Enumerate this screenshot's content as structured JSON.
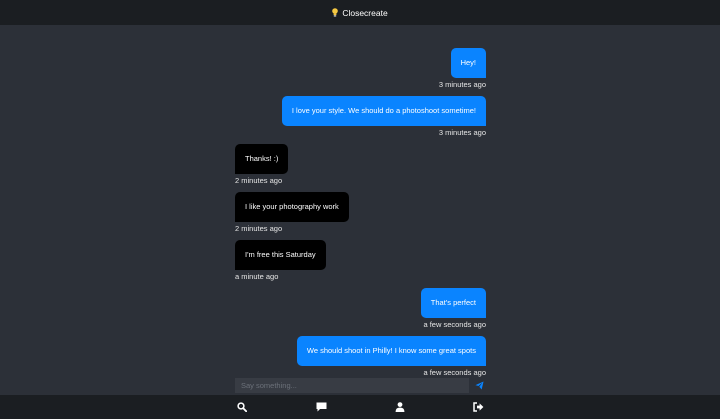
{
  "header": {
    "title": "Closecreate",
    "logo_icon": "lightbulb-icon"
  },
  "messages": [
    {
      "direction": "out",
      "text": "Hey!",
      "time": "3 minutes ago"
    },
    {
      "direction": "out",
      "text": "I love your style. We should do a photoshoot sometime!",
      "time": "3 minutes ago"
    },
    {
      "direction": "in",
      "text": "Thanks! :)",
      "time": "2 minutes ago"
    },
    {
      "direction": "in",
      "text": "I like your photography work",
      "time": "2 minutes ago"
    },
    {
      "direction": "in",
      "text": "I'm free this Saturday",
      "time": "a minute ago"
    },
    {
      "direction": "out",
      "text": "That's perfect",
      "time": "a few seconds ago"
    },
    {
      "direction": "out",
      "text": "We should shoot in Philly! I know some great spots",
      "time": "a few seconds ago"
    }
  ],
  "composer": {
    "placeholder": "Say something...",
    "value": "",
    "send_icon": "paper-plane-icon"
  },
  "bottom_nav": [
    "search-icon",
    "chat-bubble-icon",
    "user-icon",
    "sign-out-icon"
  ],
  "colors": {
    "outgoing": "#0a84ff",
    "incoming": "#000000",
    "background": "#2c3038",
    "bars": "#1b1e22"
  }
}
